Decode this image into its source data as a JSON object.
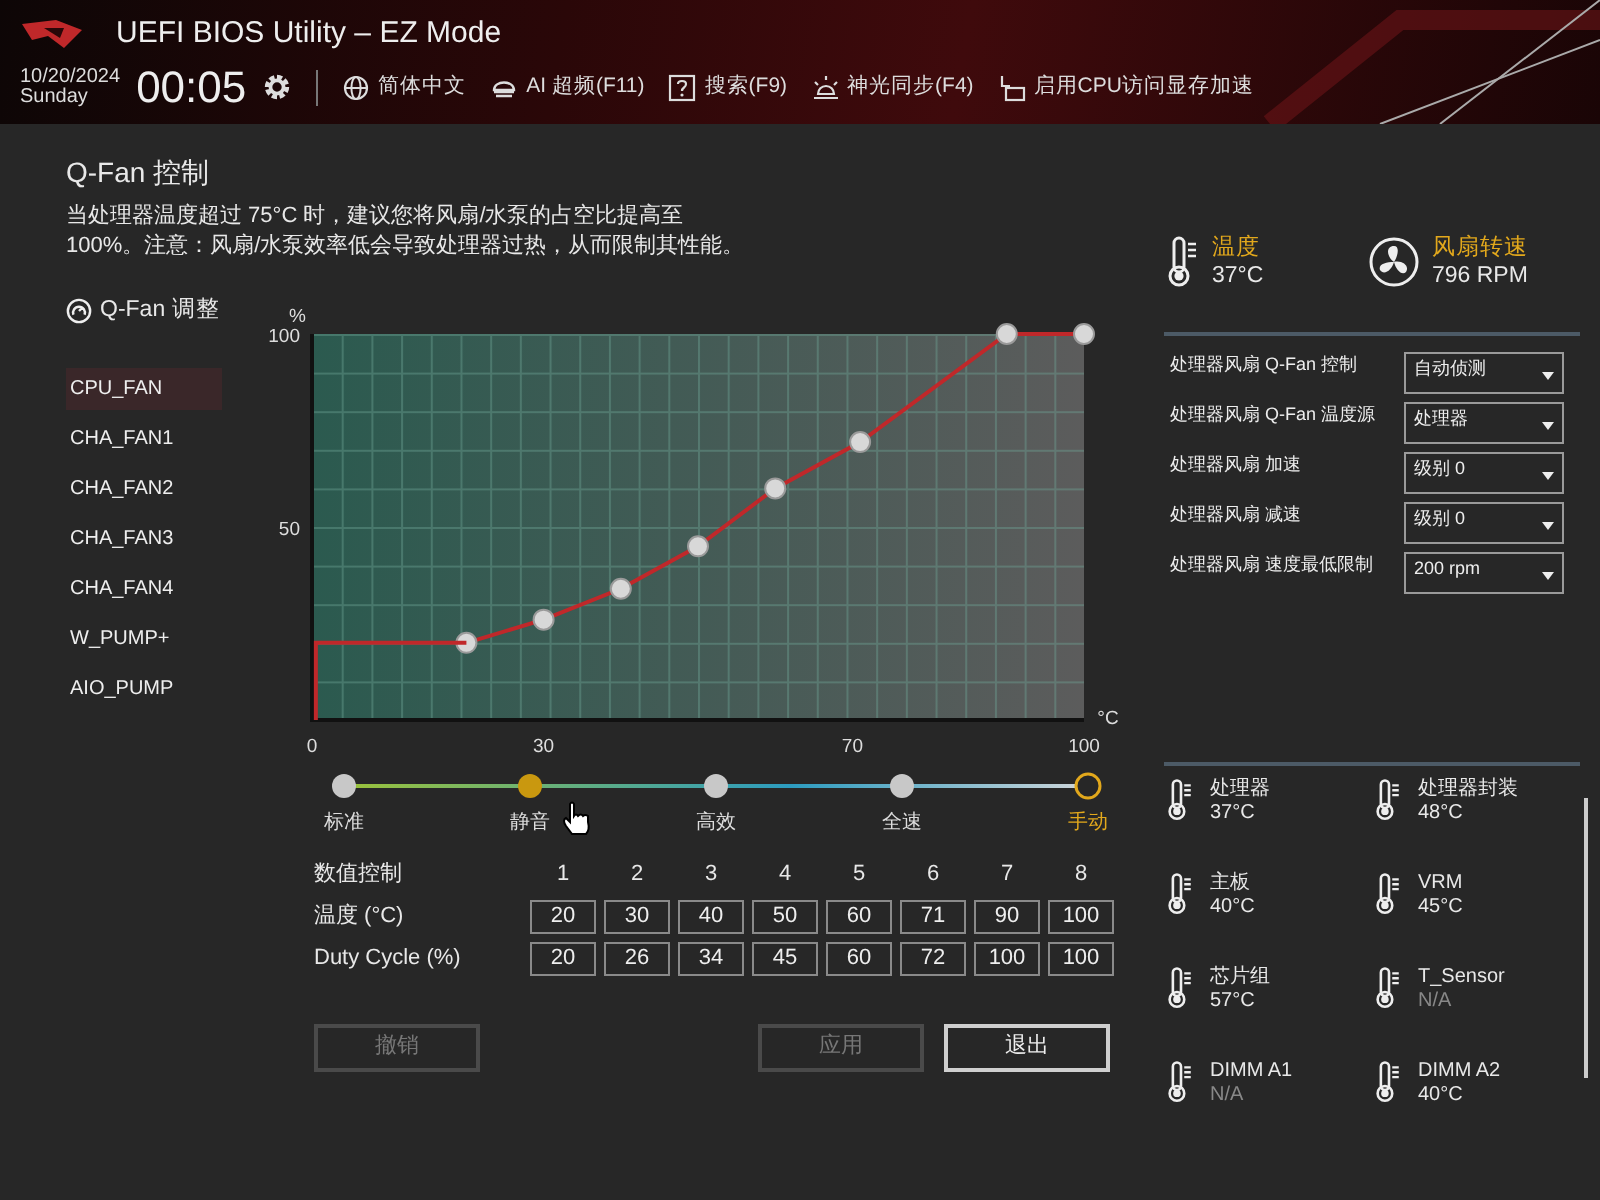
{
  "header": {
    "title": "UEFI BIOS Utility – EZ Mode",
    "date": "10/20/2024",
    "weekday": "Sunday",
    "time": "00:05",
    "menu": [
      {
        "kind": "globe",
        "label": "简体中文"
      },
      {
        "kind": "chip",
        "label": "AI 超频(F11)"
      },
      {
        "kind": "help",
        "label": "搜索(F9)"
      },
      {
        "kind": "light",
        "label": "神光同步(F4)"
      },
      {
        "kind": "memory",
        "label": "启用CPU访问显存加速"
      }
    ]
  },
  "qfan": {
    "title": "Q-Fan 控制",
    "description": "当处理器温度超过 75°C 时，建议您将风扇/水泵的占空比提高至 100%。注意：风扇/水泵效率低会导致处理器过热，从而限制其性能。",
    "tune_label": "Q-Fan 调整",
    "fans": [
      {
        "label": "CPU_FAN",
        "selected": true
      },
      {
        "label": "CHA_FAN1",
        "selected": false
      },
      {
        "label": "CHA_FAN2",
        "selected": false
      },
      {
        "label": "CHA_FAN3",
        "selected": false
      },
      {
        "label": "CHA_FAN4",
        "selected": false
      },
      {
        "label": "W_PUMP+",
        "selected": false
      },
      {
        "label": "AIO_PUMP",
        "selected": false
      }
    ],
    "chart_data": {
      "type": "line",
      "xlabel": "°C",
      "ylabel": "%",
      "x": [
        0.5,
        0.5,
        20,
        30,
        40,
        50,
        60,
        71,
        90,
        100
      ],
      "series": [
        {
          "color": "#c0282a",
          "marker": "o",
          "values": [
            null,
            null,
            20,
            26,
            34,
            45,
            60,
            72,
            100,
            100
          ]
        },
        {
          "color": "#c0282a",
          "values": [
            0,
            20,
            20,
            null,
            null,
            null,
            null,
            null,
            null,
            null
          ]
        }
      ],
      "xlim": [
        0,
        100
      ],
      "ylim": [
        0,
        100
      ],
      "xticks": [
        {
          "value": 0,
          "label": "0"
        },
        {
          "value": 30,
          "label": "30"
        },
        {
          "value": 70,
          "label": "70"
        },
        {
          "value": 100,
          "label": "100"
        }
      ],
      "yticks": [
        {
          "value": 50,
          "label": "50"
        },
        {
          "value": 100,
          "label": "100"
        }
      ]
    },
    "profiles": [
      {
        "label": "标准",
        "selected": false,
        "hovered": false
      },
      {
        "label": "静音",
        "selected": false,
        "hovered": true
      },
      {
        "label": "高效",
        "selected": false,
        "hovered": false
      },
      {
        "label": "全速",
        "selected": false,
        "hovered": false
      },
      {
        "label": "手动",
        "selected": true,
        "hovered": false
      }
    ],
    "table": {
      "header_label": "数值控制",
      "columns": [
        "1",
        "2",
        "3",
        "4",
        "5",
        "6",
        "7",
        "8"
      ],
      "rows": [
        {
          "label": "温度 (°C)",
          "values": [
            "20",
            "30",
            "40",
            "50",
            "60",
            "71",
            "90",
            "100"
          ]
        },
        {
          "label": "Duty Cycle (%)",
          "values": [
            "20",
            "26",
            "34",
            "45",
            "60",
            "72",
            "100",
            "100"
          ]
        }
      ]
    },
    "buttons": [
      {
        "label": "撤销",
        "disabled": true
      },
      {
        "label": "应用",
        "disabled": true
      },
      {
        "label": "退出",
        "disabled": false
      }
    ]
  },
  "status": {
    "temp_label": "温度",
    "temp_value": "37°C",
    "fan_label": "风扇转速",
    "fan_value": "796 RPM"
  },
  "settings": [
    {
      "label": "处理器风扇 Q-Fan 控制",
      "value": "自动侦测"
    },
    {
      "label": "处理器风扇 Q-Fan 温度源",
      "value": "处理器"
    },
    {
      "label": "处理器风扇 加速",
      "value": "级别 0"
    },
    {
      "label": "处理器风扇 减速",
      "value": "级别 0"
    },
    {
      "label": "处理器风扇 速度最低限制",
      "value": "200 rpm"
    }
  ],
  "sensors": [
    {
      "label": "处理器",
      "value": "37°C",
      "available": true
    },
    {
      "label": "处理器封装",
      "value": "48°C",
      "available": true
    },
    {
      "label": "主板",
      "value": "40°C",
      "available": true
    },
    {
      "label": "VRM",
      "value": "45°C",
      "available": true
    },
    {
      "label": "芯片组",
      "value": "57°C",
      "available": true
    },
    {
      "label": "T_Sensor",
      "value": "N/A",
      "available": false
    },
    {
      "label": "DIMM A1",
      "value": "N/A",
      "available": false
    },
    {
      "label": "DIMM A2",
      "value": "40°C",
      "available": true
    }
  ]
}
